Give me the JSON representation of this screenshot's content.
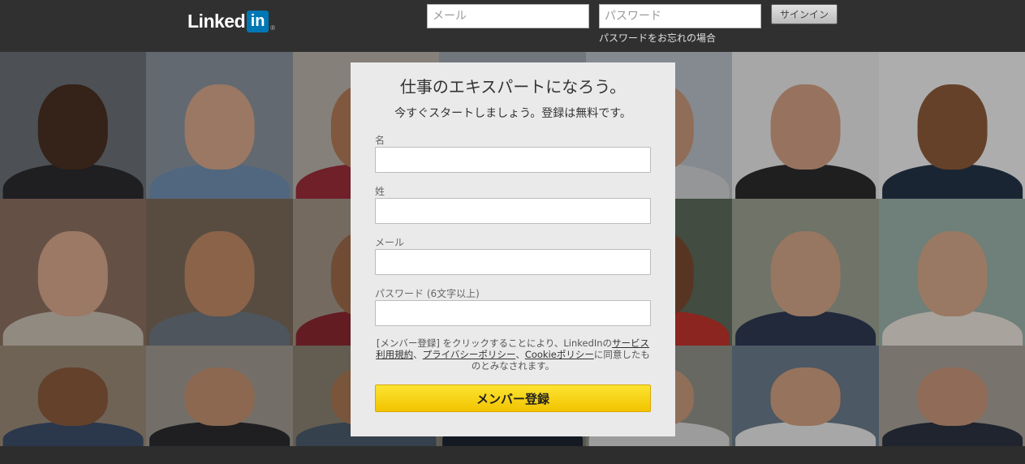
{
  "header": {
    "logo_text": "Linked",
    "logo_in": "in",
    "logo_reg": "®",
    "email_placeholder": "メール",
    "password_placeholder": "パスワード",
    "signin_label": "サインイン",
    "forgot_link": "パスワードをお忘れの場合"
  },
  "card": {
    "title": "仕事のエキスパートになろう。",
    "subtitle": "今すぐスタートしましょう。登録は無料です。",
    "first_name_label": "名",
    "last_name_label": "姓",
    "email_label": "メール",
    "password_label": "パスワード (6文字以上)",
    "terms_prefix": "[メンバー登録] をクリックすることにより、LinkedInの",
    "terms_link_service": "サービス利用規約",
    "terms_sep1": "、",
    "terms_link_privacy": "プライバシーポリシー",
    "terms_sep2": "、",
    "terms_link_cookie": "Cookieポリシー",
    "terms_suffix": "に同意したものとみなされます。",
    "join_label": "メンバー登録"
  },
  "colors": {
    "header_bg": "#303030",
    "brand_blue": "#0077b5",
    "card_bg": "#eaeaea",
    "cta_yellow": "#f5cc0a"
  },
  "background_photos": [
    {
      "bg": "#6b6f75",
      "skin": "#4a3022",
      "cloth": "#2b2a2e"
    },
    {
      "bg": "#8a929c",
      "skin": "#d6a789",
      "cloth": "#6f8fb0"
    },
    {
      "bg": "#b9b3aa",
      "skin": "#b07a58",
      "cloth": "#9a2d3a"
    },
    {
      "bg": "#9ea6ae",
      "skin": "#c99a7c",
      "cloth": "#d8d8d8"
    },
    {
      "bg": "#b8c0c8",
      "skin": "#c8987a",
      "cloth": "#cfd0d2"
    },
    {
      "bg": "#e8e8e8",
      "skin": "#d2a084",
      "cloth": "#2c2c2c"
    },
    {
      "bg": "#f0f0f0",
      "skin": "#8e5a3a",
      "cloth": "#253448"
    },
    {
      "bg": "#8c7060",
      "skin": "#d7a88c",
      "cloth": "#c9c0b2"
    },
    {
      "bg": "#7a6a5a",
      "skin": "#c08a66",
      "cloth": "#6d7780"
    },
    {
      "bg": "#a19486",
      "skin": "#9c6a48",
      "cloth": "#8a2830"
    },
    {
      "bg": "#8e8a80",
      "skin": "#b08060",
      "cloth": "#3a3f48"
    },
    {
      "bg": "#5c6a5a",
      "skin": "#7a4a30",
      "cloth": "#c0342c"
    },
    {
      "bg": "#9aa090",
      "skin": "#d2a488",
      "cloth": "#2f3a52"
    },
    {
      "bg": "#9ab0a8",
      "skin": "#d4a88a",
      "cloth": "#e9e2d8"
    },
    {
      "bg": "#9a8a78",
      "skin": "#8a5a3c",
      "cloth": "#3c4d68"
    },
    {
      "bg": "#a09a90",
      "skin": "#c29070",
      "cloth": "#2c2c30"
    },
    {
      "bg": "#8a8070",
      "skin": "#a87654",
      "cloth": "#4a5a6a"
    },
    {
      "bg": "#7a7a74",
      "skin": "#c99878",
      "cloth": "#1e2530"
    },
    {
      "bg": "#909088",
      "skin": "#c89a7c",
      "cloth": "#d8d8d8"
    },
    {
      "bg": "#6a7a8a",
      "skin": "#d0a080",
      "cloth": "#e8e8e8"
    },
    {
      "bg": "#a8a098",
      "skin": "#c8967a",
      "cloth": "#2c3240"
    }
  ]
}
